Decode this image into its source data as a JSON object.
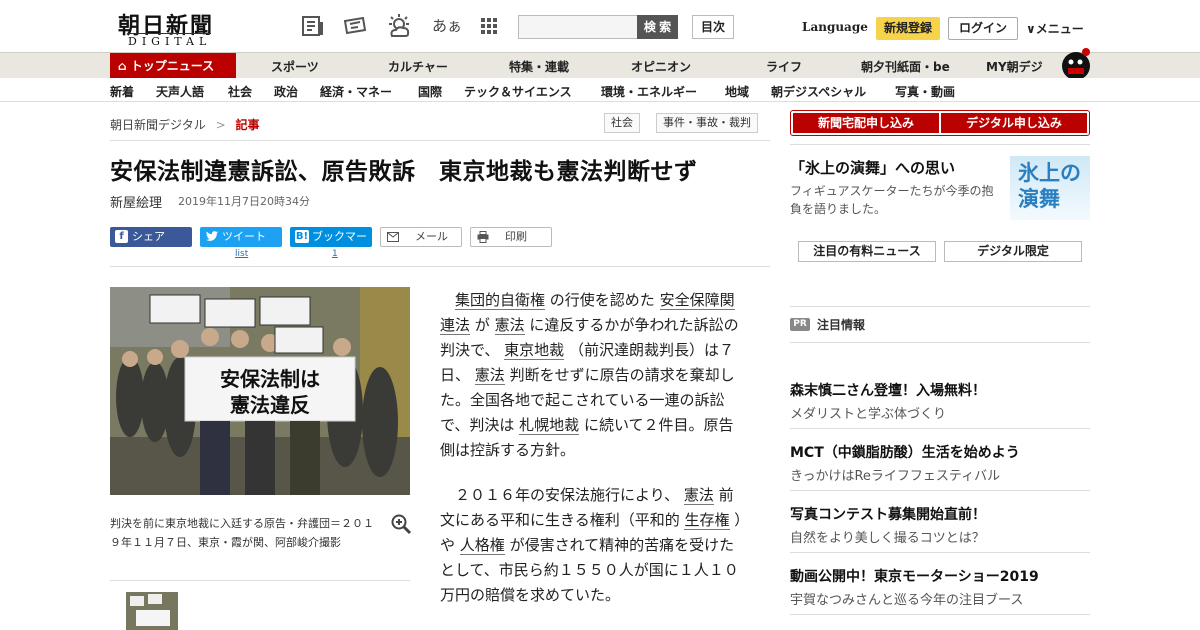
{
  "header": {
    "logo_main": "朝日新聞",
    "logo_sub": "DIGITAL",
    "search_placeholder": "",
    "search_button": "検 索",
    "toc_button": "目次",
    "language": "Language",
    "signup": "新規登録",
    "login": "ログイン",
    "menu": "メニュー",
    "kana_icon": "あぁ"
  },
  "nav_primary": [
    "トップニュース",
    "スポーツ",
    "カルチャー",
    "特集・連載",
    "オピニオン",
    "ライフ",
    "朝夕刊紙面・be",
    "MY朝デジ"
  ],
  "nav_secondary": [
    "新着",
    "天声人語",
    "社会",
    "政治",
    "経済・マネー",
    "国際",
    "テック＆サイエンス",
    "環境・エネルギー",
    "地域",
    "朝デジスペシャル",
    "写真・動画"
  ],
  "breadcrumb": {
    "home": "朝日新聞デジタル",
    "sep": ">",
    "current": "記事"
  },
  "tags": [
    "社会",
    "事件・事故・裁判"
  ],
  "article": {
    "headline": "安保法制違憲訴訟、原告敗訴　東京地裁も憲法判断せず",
    "author": "新屋絵理",
    "date": "2019年11月7日20時34分",
    "share": {
      "facebook": "シェア",
      "twitter": "ツイート",
      "twitter_count": "list",
      "hatena": "ブックマーク",
      "hatena_count": "1",
      "mail": "メール",
      "print": "印刷"
    },
    "photo_sign": "安保法制は\n憲法違反",
    "caption": "判決を前に東京地裁に入廷する原告・弁護団＝２０１９年１１月７日、東京・霞が関、阿部峻介撮影",
    "p1": [
      {
        "t": "集団的自衛権",
        "link": true
      },
      {
        "t": " の行使を認めた ",
        "link": false
      },
      {
        "t": "安全保障関連法",
        "link": true
      },
      {
        "t": " が ",
        "link": false
      },
      {
        "t": "憲法",
        "link": true
      },
      {
        "t": " に違反するかが争われた訴訟の判決で、 ",
        "link": false
      },
      {
        "t": "東京地裁",
        "link": true
      },
      {
        "t": " （前沢達朗裁判長）は７日、 ",
        "link": false
      },
      {
        "t": "憲法",
        "link": true
      },
      {
        "t": " 判断をせずに原告の請求を棄却した。全国各地で起こされている一連の訴訟で、判決は ",
        "link": false
      },
      {
        "t": "札幌地裁",
        "link": true
      },
      {
        "t": " に続いて２件目。原告側は控訴する方針。",
        "link": false
      }
    ],
    "p2": [
      {
        "t": "２０１６年の安保法施行により、 ",
        "link": false
      },
      {
        "t": "憲法",
        "link": true
      },
      {
        "t": " 前文にある平和に生きる権利（平和的 ",
        "link": false
      },
      {
        "t": "生存権",
        "link": true
      },
      {
        "t": " ）や ",
        "link": false
      },
      {
        "t": "人格権",
        "link": true
      },
      {
        "t": " が侵害されて精神的苦痛を受けたとして、市民ら約１５５０人が国に１人１０万円の賠償を求めていた。",
        "link": false
      }
    ]
  },
  "sidebar": {
    "subscribe_paper": "新聞宅配申し込み",
    "subscribe_digital": "デジタル申し込み",
    "promo_title": "「氷上の演舞」への思い",
    "promo_desc": "フィギュアスケーターたちが今季の抱負を語りました。",
    "promo_img_text": "氷上の\n演舞",
    "tab_paid": "注目の有料ニュース",
    "tab_digital": "デジタル限定",
    "pr_badge": "PR",
    "pr_title": "注目情報",
    "items": [
      {
        "title": "森末慎二さん登壇！入場無料！",
        "desc": "メダリストと学ぶ体づくり"
      },
      {
        "title": "MCT（中鎖脂肪酸）生活を始めよう",
        "desc": "きっかけはReライフフェスティバル"
      },
      {
        "title": "写真コンテスト募集開始直前！",
        "desc": "自然をより美しく撮るコツとは？"
      },
      {
        "title": "動画公開中！東京モーターショー2019",
        "desc": "宇賀なつみさんと巡る今年の注目ブース"
      }
    ]
  },
  "colors": {
    "brand_red": "#bb0000",
    "signup_yellow": "#f6d34a",
    "facebook": "#3b5998",
    "twitter": "#1da1f2",
    "hatena": "#008fde"
  }
}
